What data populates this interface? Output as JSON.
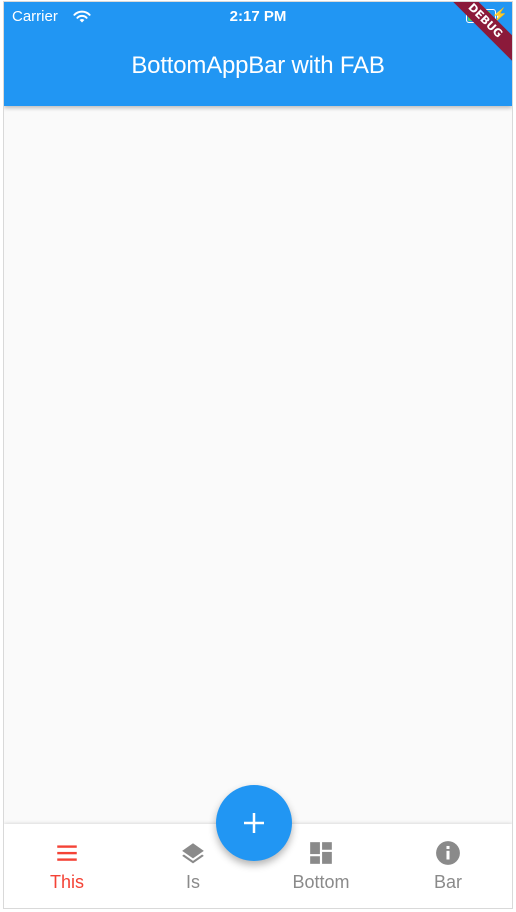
{
  "status_bar": {
    "carrier": "Carrier",
    "time": "2:17 PM",
    "wifi_icon": "wifi-icon",
    "battery_icon": "battery-icon",
    "charging_icon": "charging-bolt-icon"
  },
  "app_bar": {
    "title": "BottomAppBar with FAB"
  },
  "debug_banner": {
    "label": "DEBUG",
    "color": "#8b1a3a"
  },
  "fab": {
    "icon": "plus-icon",
    "color": "#2196f3"
  },
  "bottom_nav": {
    "active_color": "#f44336",
    "inactive_color": "#8a8a8a",
    "items": [
      {
        "label": "This",
        "icon": "menu-icon",
        "active": true
      },
      {
        "label": "Is",
        "icon": "layers-icon",
        "active": false
      },
      {
        "label": "Bottom",
        "icon": "dashboard-icon",
        "active": false
      },
      {
        "label": "Bar",
        "icon": "info-icon",
        "active": false
      }
    ]
  },
  "colors": {
    "primary": "#2196f3",
    "background": "#fafafa"
  }
}
